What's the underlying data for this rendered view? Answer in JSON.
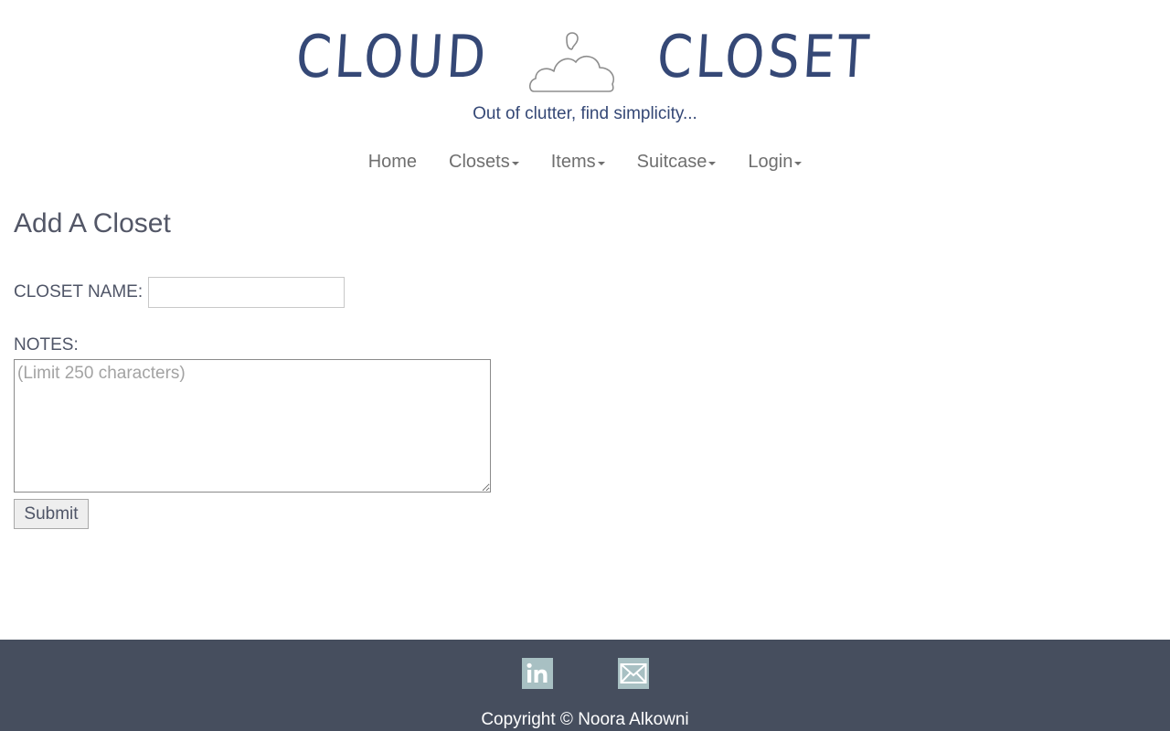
{
  "header": {
    "logo_left": "CLOUD",
    "logo_right": "CLOSET",
    "logo_icon": "cloud-hanger-icon",
    "tagline": "Out of clutter, find simplicity..."
  },
  "nav": {
    "items": [
      {
        "label": "Home",
        "dropdown": false
      },
      {
        "label": "Closets",
        "dropdown": true
      },
      {
        "label": "Items",
        "dropdown": true
      },
      {
        "label": "Suitcase",
        "dropdown": true
      },
      {
        "label": "Login",
        "dropdown": true
      }
    ]
  },
  "form": {
    "title": "Add A Closet",
    "closet_name_label": "CLOSET NAME:",
    "closet_name_value": "",
    "notes_label": "NOTES:",
    "notes_placeholder": "(Limit 250 characters)",
    "submit_label": "Submit"
  },
  "footer": {
    "social": [
      {
        "icon": "linkedin-icon",
        "text": "in"
      },
      {
        "icon": "mail-icon"
      }
    ],
    "copyright": "Copyright © Noora Alkowni"
  },
  "colors": {
    "brand": "#354876",
    "footer_bg": "#464e5e",
    "social_bg": "#a8c0c3"
  }
}
